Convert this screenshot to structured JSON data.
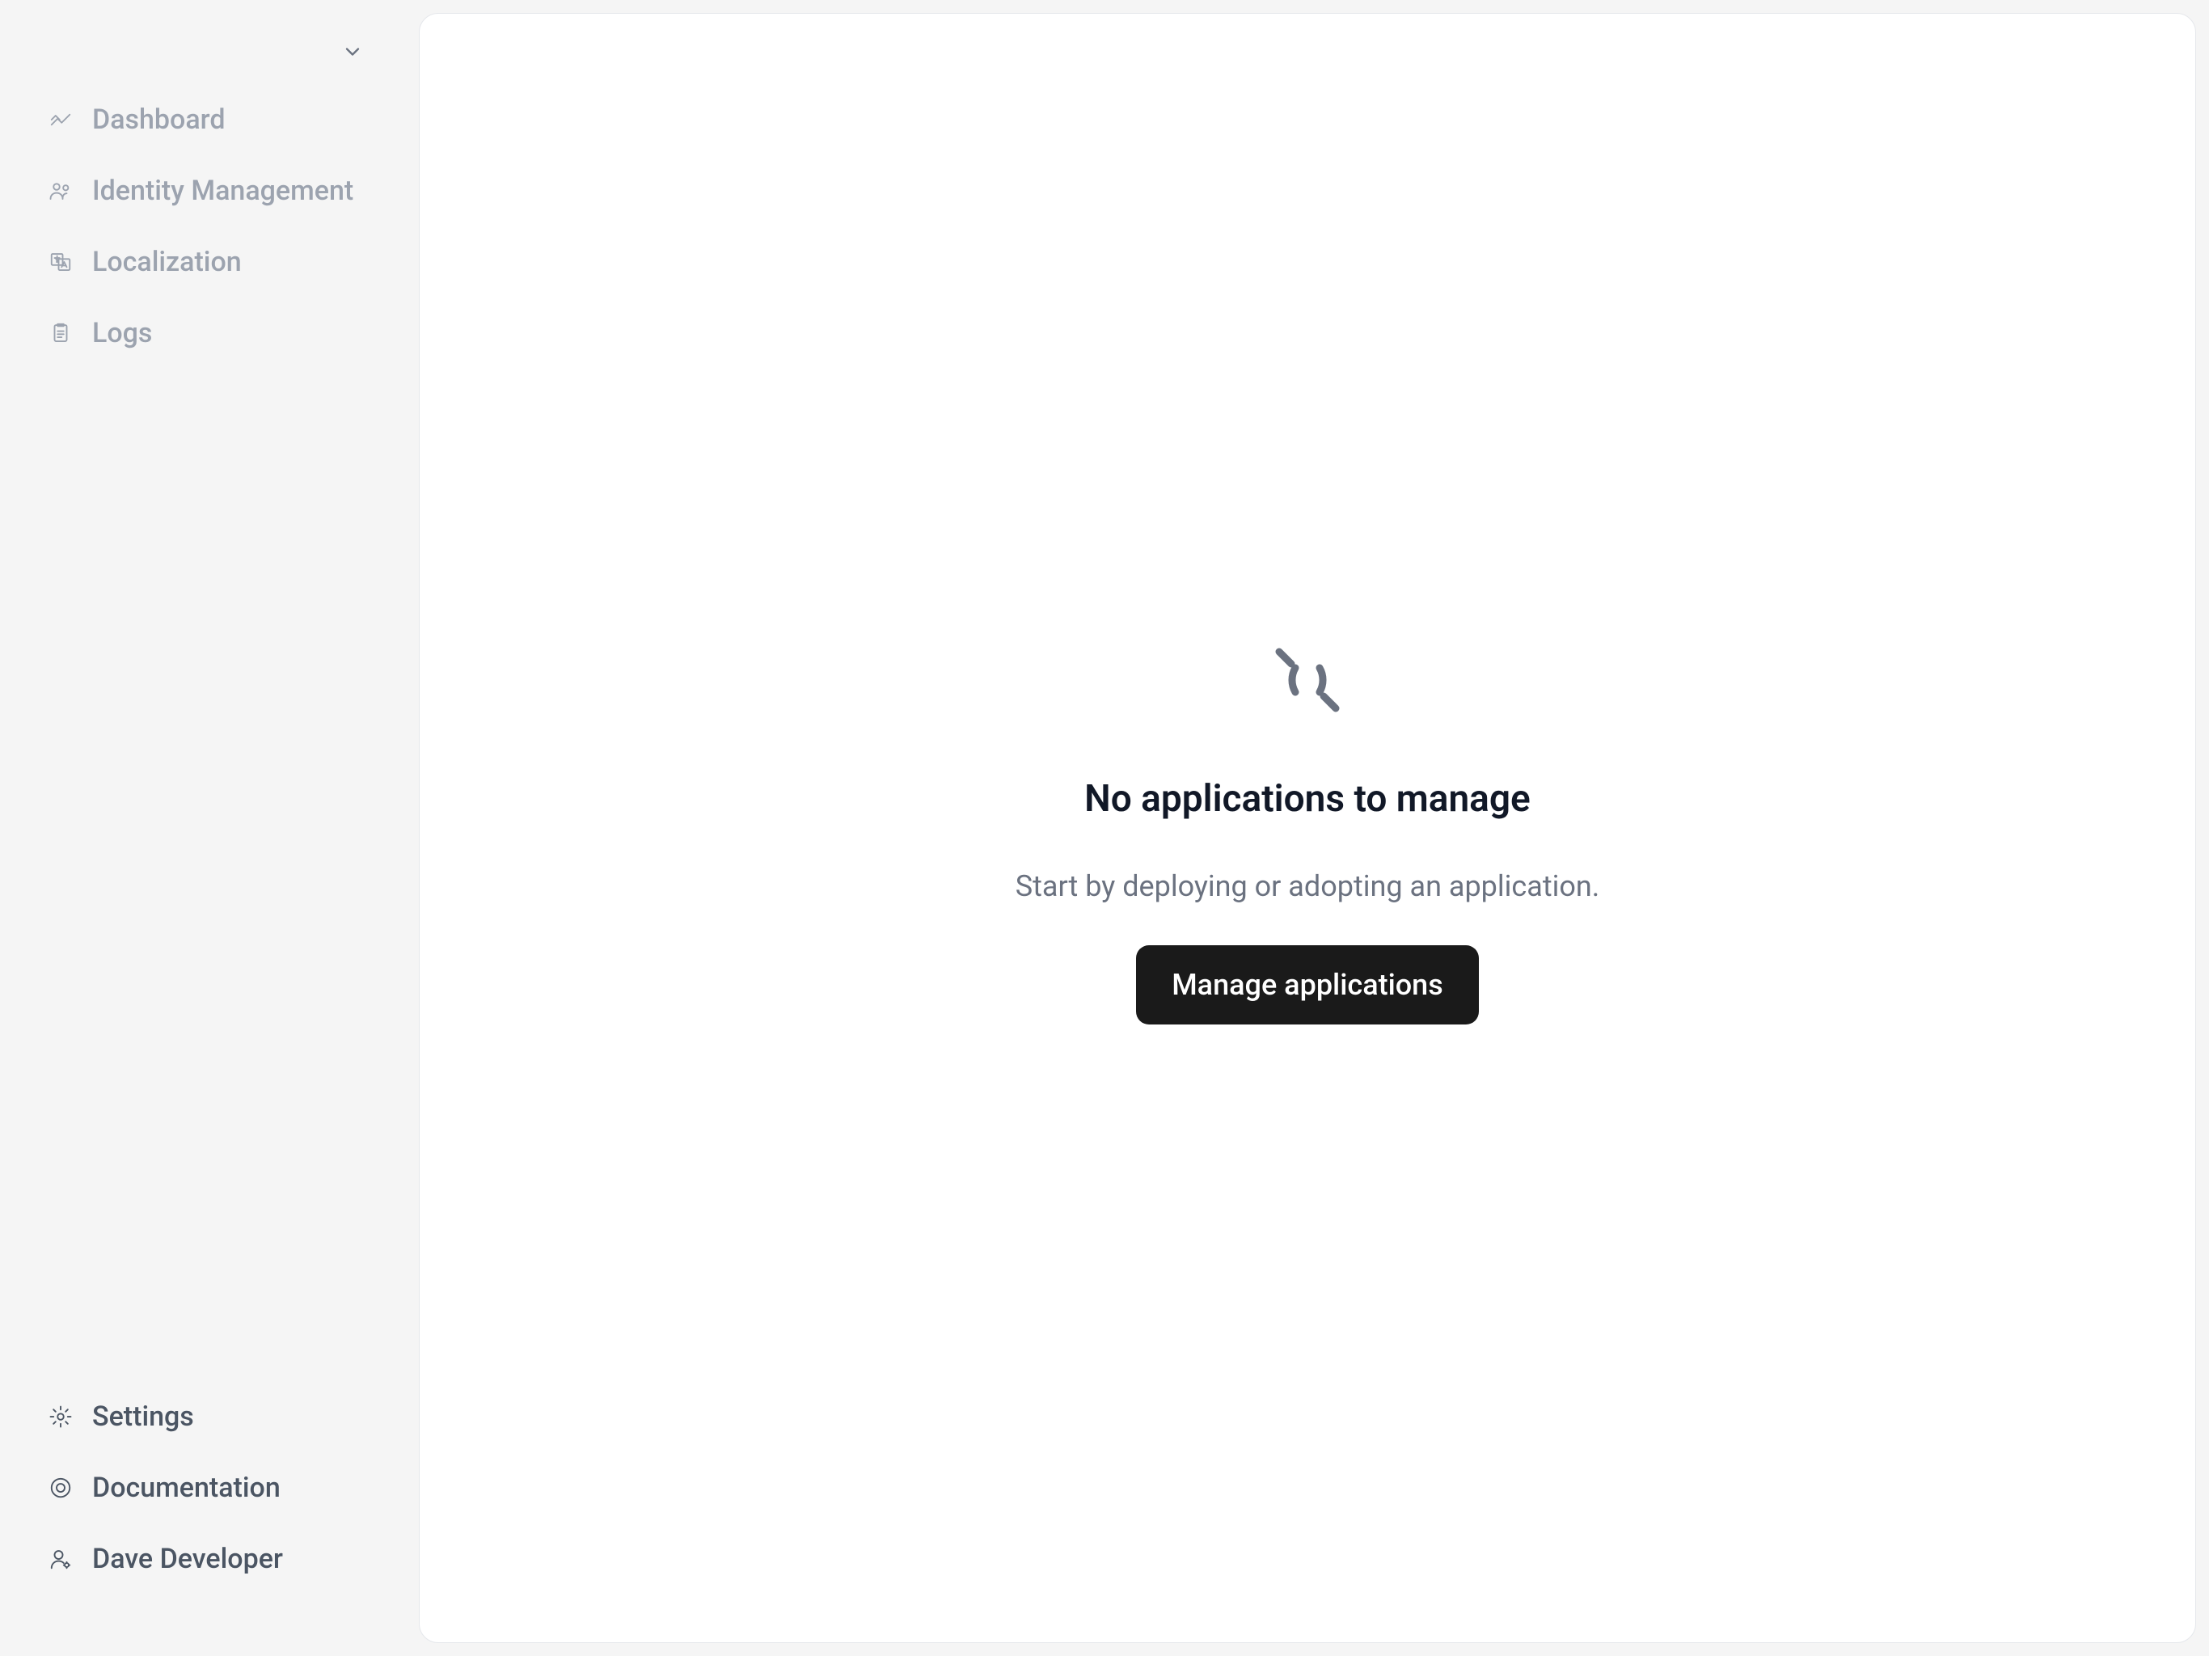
{
  "sidebar": {
    "nav": [
      {
        "label": "Dashboard",
        "icon": "dashboard-icon"
      },
      {
        "label": "Identity Management",
        "icon": "identity-icon"
      },
      {
        "label": "Localization",
        "icon": "localization-icon"
      },
      {
        "label": "Logs",
        "icon": "logs-icon"
      }
    ],
    "footer": [
      {
        "label": "Settings",
        "icon": "settings-icon"
      },
      {
        "label": "Documentation",
        "icon": "documentation-icon"
      },
      {
        "label": "Dave Developer",
        "icon": "user-icon"
      }
    ]
  },
  "emptyState": {
    "title": "No applications to manage",
    "subtitle": "Start by deploying or adopting an application.",
    "buttonLabel": "Manage applications"
  }
}
